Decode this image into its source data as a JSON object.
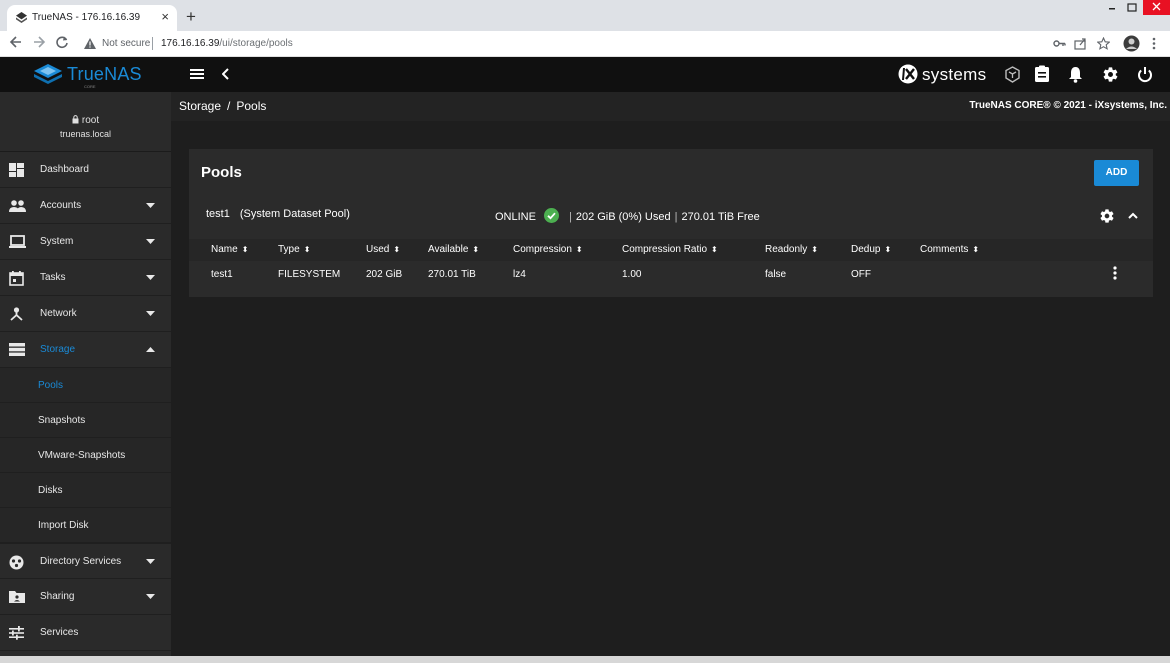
{
  "browser": {
    "tab_title": "TrueNAS - 176.16.16.39",
    "tab_close": "×",
    "new_tab": "+",
    "not_secure": "Not secure",
    "url_host": "176.16.16.39",
    "url_path": "/ui/storage/pools"
  },
  "header": {
    "brand": "TrueNAS",
    "edition": "CORE",
    "vendor": "systems"
  },
  "user": {
    "name": "root",
    "host": "truenas.local"
  },
  "sidebar": {
    "items": [
      {
        "label": "Dashboard",
        "icon": "dashboard-icon"
      },
      {
        "label": "Accounts",
        "icon": "accounts-icon"
      },
      {
        "label": "System",
        "icon": "system-icon"
      },
      {
        "label": "Tasks",
        "icon": "tasks-icon"
      },
      {
        "label": "Network",
        "icon": "network-icon"
      },
      {
        "label": "Storage",
        "icon": "storage-icon"
      }
    ],
    "storage_sub": [
      {
        "label": "Pools"
      },
      {
        "label": "Snapshots"
      },
      {
        "label": "VMware-Snapshots"
      },
      {
        "label": "Disks"
      },
      {
        "label": "Import Disk"
      }
    ],
    "after_items": [
      {
        "label": "Directory Services",
        "icon": "directory-services-icon"
      },
      {
        "label": "Sharing",
        "icon": "sharing-icon"
      },
      {
        "label": "Services",
        "icon": "services-icon"
      }
    ]
  },
  "breadcrumb": {
    "section": "Storage",
    "separator": "/",
    "page": "Pools"
  },
  "copyright": "TrueNAS CORE® © 2021 - iXsystems, Inc.",
  "pools": {
    "title": "Pools",
    "add_label": "ADD",
    "pool": {
      "name": "test1",
      "system_dataset": "(System Dataset Pool)",
      "status": "ONLINE",
      "used_summary": "202 GiB (0%) Used",
      "free_summary": "270.01 TiB Free",
      "status_color": "#4caf50"
    },
    "columns": [
      "Name",
      "Type",
      "Used",
      "Available",
      "Compression",
      "Compression Ratio",
      "Readonly",
      "Dedup",
      "Comments"
    ],
    "rows": [
      {
        "name": "test1",
        "type": "FILESYSTEM",
        "used": "202 GiB",
        "available": "270.01 TiB",
        "compression": "lz4",
        "ratio": "1.00",
        "readonly": "false",
        "dedup": "OFF",
        "comments": ""
      }
    ]
  },
  "colors": {
    "accent": "#1a8ad6",
    "background": "#1e1e1e",
    "sidebar": "#2a2a2a",
    "card": "#2b2b2b"
  }
}
